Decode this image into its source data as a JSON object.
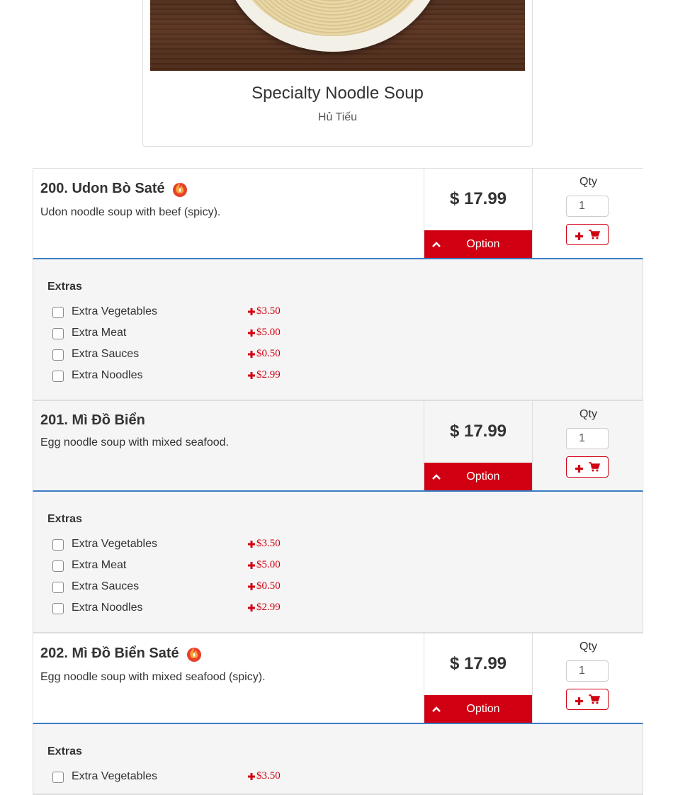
{
  "category": {
    "title": "Specialty Noodle Soup",
    "subtitle": "Hủ Tiếu"
  },
  "accent_color": "#d00012",
  "divider_color": "#3b7cc4",
  "items": [
    {
      "title": "200. Udon Bò Saté",
      "description": "Udon noodle soup with beef (spicy).",
      "spicy": true,
      "price": "$ 17.99",
      "option_label": "Option",
      "qty_label": "Qty",
      "qty_value": "1",
      "extras_title": "Extras",
      "extras": [
        {
          "name": "Extra Vegetables",
          "price": "$3.50"
        },
        {
          "name": "Extra Meat",
          "price": "$5.00"
        },
        {
          "name": "Extra Sauces",
          "price": "$0.50"
        },
        {
          "name": "Extra Noodles",
          "price": "$2.99"
        }
      ]
    },
    {
      "title": "201. Mì Đồ Biển",
      "description": "Egg noodle soup with mixed seafood.",
      "spicy": false,
      "price": "$ 17.99",
      "option_label": "Option",
      "qty_label": "Qty",
      "qty_value": "1",
      "extras_title": "Extras",
      "extras": [
        {
          "name": "Extra Vegetables",
          "price": "$3.50"
        },
        {
          "name": "Extra Meat",
          "price": "$5.00"
        },
        {
          "name": "Extra Sauces",
          "price": "$0.50"
        },
        {
          "name": "Extra Noodles",
          "price": "$2.99"
        }
      ]
    },
    {
      "title": "202. Mì Đồ Biển Saté",
      "description": "Egg noodle soup with mixed seafood (spicy).",
      "spicy": true,
      "price": "$ 17.99",
      "option_label": "Option",
      "qty_label": "Qty",
      "qty_value": "1",
      "extras_title": "Extras",
      "extras": [
        {
          "name": "Extra Vegetables",
          "price": "$3.50"
        }
      ]
    }
  ]
}
